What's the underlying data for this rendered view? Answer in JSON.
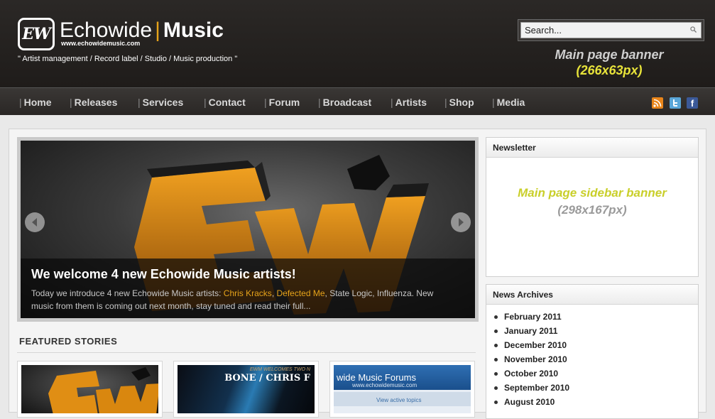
{
  "header": {
    "logo_initials": "EW",
    "logo_name_part1": "Echowide",
    "logo_separator": "|",
    "logo_name_part2": "Music",
    "logo_url": "www.echowidemusic.com",
    "tagline": "\" Artist management / Record label / Studio / Music production \"",
    "search_value": "Search...",
    "banner_line1": "Main page banner",
    "banner_line2": "(266x63px)"
  },
  "nav": {
    "separator": "|",
    "items": [
      "Home",
      "Releases",
      "Services",
      "Contact",
      "Forum",
      "Broadcast",
      "Artists",
      "Shop",
      "Media"
    ],
    "social_fb_letter": "f"
  },
  "slider": {
    "title": "We welcome 4 new Echowide Music artists!",
    "desc_prefix": "Today we introduce 4 new Echowide Music artists: ",
    "desc_highlight_1": "Chris Kracks",
    "desc_comma": ", ",
    "desc_highlight_2": "Defected Me",
    "desc_suffix": ", State Logic, Influenza. New music from them is coming out next month, stay tuned and read their full..."
  },
  "featured": {
    "title": "FEATURED STORIES",
    "thumb2_small": "EWM WELCOMES TWO N",
    "thumb2_big": "BONE / CHRIS F",
    "thumb3_title": "wide Music Forums",
    "thumb3_url": "www.echowidemusic.com",
    "thumb3_link": "View active topics"
  },
  "sidebar": {
    "newsletter_title": "Newsletter",
    "banner_line1": "Main page sidebar banner",
    "banner_line2": "(298x167px)",
    "archives_title": "News Archives",
    "archives": [
      "February 2011",
      "January 2011",
      "December 2010",
      "November 2010",
      "October 2010",
      "September 2010",
      "August 2010"
    ]
  },
  "colors": {
    "accent_orange": "#e6a31a",
    "banner_yellow": "#e7e33a",
    "header_bg": "#231f1d"
  }
}
